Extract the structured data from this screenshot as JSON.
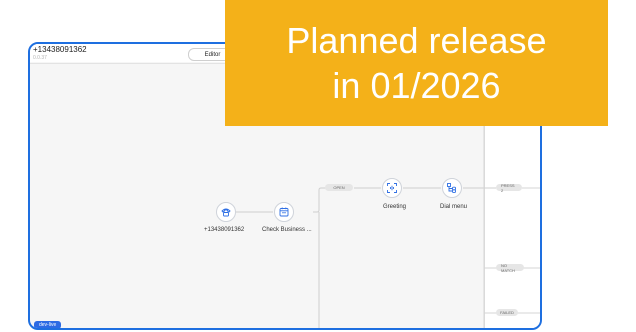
{
  "flow": {
    "phone_title": "+13438091362",
    "version": "0.0.37",
    "editor_label": "Editor",
    "environment_badge": "dev-live"
  },
  "nodes": [
    {
      "label": "+13438091362",
      "icon": "phone-icon"
    },
    {
      "label": "Check Business ...",
      "icon": "calendar-icon"
    },
    {
      "label": "Greeting",
      "icon": "voice-scan-icon"
    },
    {
      "label": "Dial menu",
      "icon": "dial-menu-icon"
    }
  ],
  "branches": {
    "open": "OPEN",
    "press_2": "PRESS 2",
    "no_match": "NO MATCH",
    "failed": "FAILED"
  },
  "banner": {
    "line1": "Planned release",
    "line2": "in 01/2026",
    "color": "#f4b119"
  },
  "accent_color": "#1e6fe0"
}
